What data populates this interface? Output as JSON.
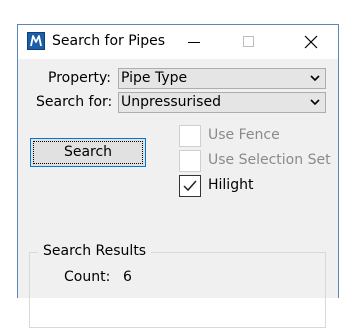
{
  "window": {
    "title": "Search for Pipes",
    "icon": "microstation-logo-icon",
    "controls": [
      "minimize-icon",
      "maximize-icon",
      "close-icon"
    ]
  },
  "form": {
    "property_label": "Property:",
    "property_value": "Pipe Type",
    "search_for_label": "Search for:",
    "search_for_value": "Unpressurised",
    "search_button_label": "Search"
  },
  "options": [
    {
      "label": "Use Fence",
      "checked": false,
      "enabled": false
    },
    {
      "label": "Use Selection Set",
      "checked": false,
      "enabled": false
    },
    {
      "label": "Hilight",
      "checked": true,
      "enabled": true
    }
  ],
  "results": {
    "group_title": "Search Results",
    "count_label": "Count:",
    "count_value": "6"
  },
  "colors": {
    "client_bg": "#f0f0f0",
    "focus_border": "#0078d7",
    "disabled_text": "#8a8a8a"
  }
}
